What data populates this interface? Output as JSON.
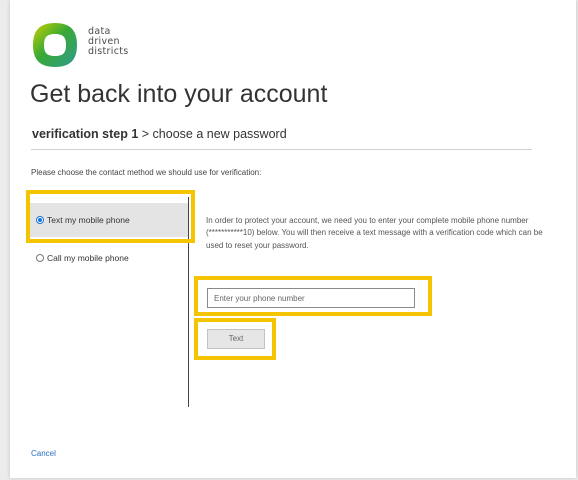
{
  "brand": {
    "logo_icon": "data-driven-districts-logo",
    "name_line1": "data",
    "name_line2": "driven",
    "name_line3": "districts",
    "colors": {
      "green": "#3aa935",
      "yellow": "#c8d200",
      "teal": "#2f9b8f"
    }
  },
  "page": {
    "title": "Get back into your account",
    "step_bold": "verification step 1",
    "step_rest": " > choose a new password",
    "instruction": "Please choose the contact method we should use for verification:"
  },
  "methods": [
    {
      "label": "Text my mobile phone",
      "selected": true
    },
    {
      "label": "Call my mobile phone",
      "selected": false
    }
  ],
  "details": {
    "info": "In order to protect your account, we need you to enter your complete mobile phone number (***********10) below. You will then receive a text message with a verification code which can be used to reset your password.",
    "phone_placeholder": "Enter your phone number",
    "phone_value": "",
    "text_button": "Text"
  },
  "footer": {
    "cancel": "Cancel"
  },
  "highlight_color": "#f5c400",
  "link_color": "#2b6fc2"
}
